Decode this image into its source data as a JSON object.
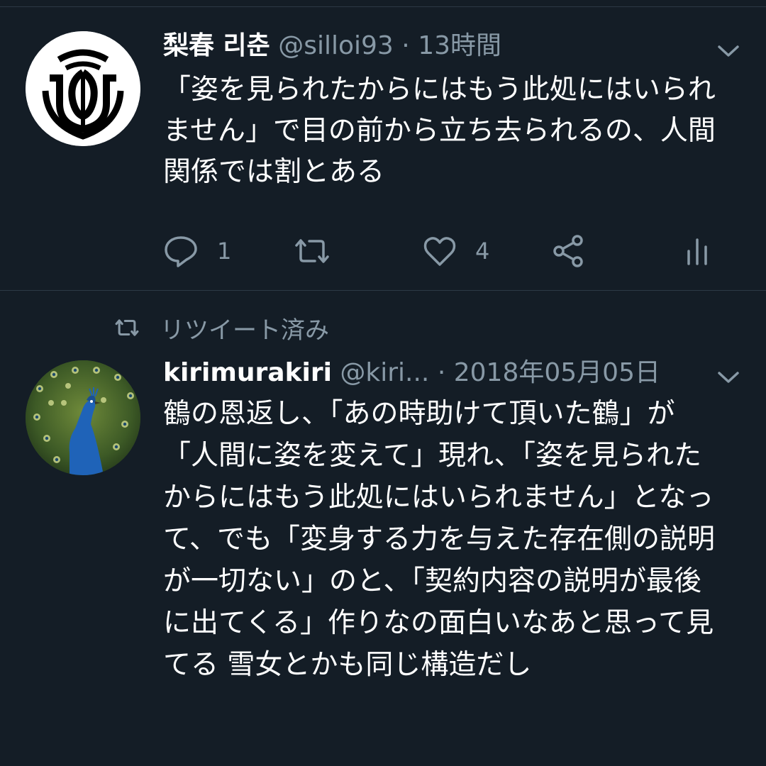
{
  "tweets": [
    {
      "display_name": "梨春 리춘",
      "handle": "@silloi93",
      "separator": "·",
      "time": "13時間",
      "text": "「姿を見られたからにはもう此処にはいられません」で目の前から立ち去られるの、人間関係では割とある",
      "reply_count": "1",
      "retweet_count": "",
      "like_count": "4",
      "avatar_icon": "crest-logo-icon"
    },
    {
      "retweet_label": "リツイート済み",
      "display_name": "kirimurakiri",
      "handle": "@kiri...",
      "separator": "·",
      "time": "2018年05月05日",
      "text": "鶴の恩返し、「あの時助けて頂いた鶴」が「人間に姿を変えて」現れ、「姿を見られたからにはもう此処にはいられません」となって、でも「変身する力を与えた存在側の説明が一切ない」のと、「契約内容の説明が最後に出てくる」作りなの面白いなあと思って見てる 雪女とかも同じ構造だし",
      "avatar_icon": "peacock-photo"
    }
  ],
  "colors": {
    "background": "#141d26",
    "text": "#ffffff",
    "secondary": "#8899a6",
    "divider": "#2c3945"
  }
}
